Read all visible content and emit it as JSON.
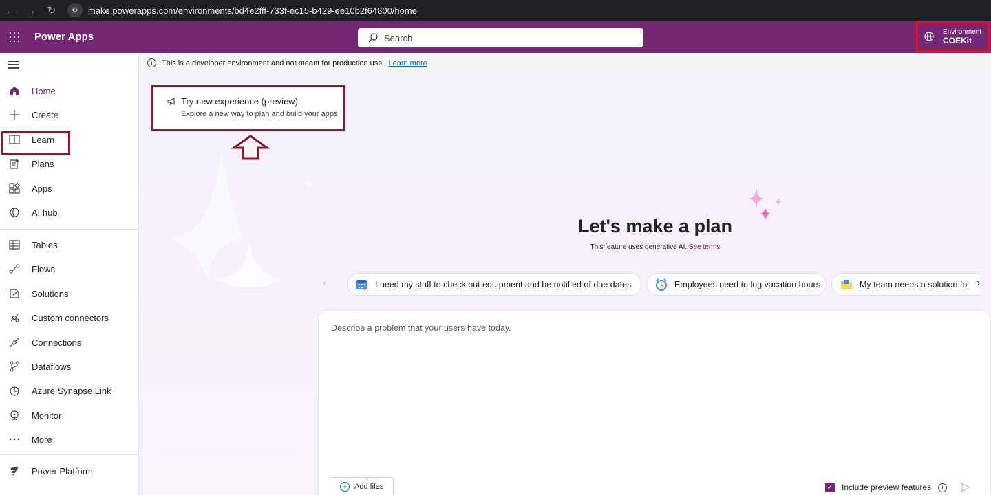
{
  "browser": {
    "url": "make.powerapps.com/environments/bd4e2fff-733f-ec15-b429-ee10b2f64800/home"
  },
  "header": {
    "app_title": "Power Apps",
    "search_placeholder": "Search",
    "environment_label": "Environment",
    "environment_name": "COEKit"
  },
  "sidebar": {
    "items": [
      {
        "label": "Home",
        "icon": "home-icon"
      },
      {
        "label": "Create",
        "icon": "plus-icon"
      },
      {
        "label": "Learn",
        "icon": "book-icon"
      },
      {
        "label": "Plans",
        "icon": "plans-icon"
      },
      {
        "label": "Apps",
        "icon": "apps-icon"
      },
      {
        "label": "AI hub",
        "icon": "ai-hub-icon"
      },
      {
        "label": "Tables",
        "icon": "table-icon"
      },
      {
        "label": "Flows",
        "icon": "flows-icon"
      },
      {
        "label": "Solutions",
        "icon": "solutions-icon"
      },
      {
        "label": "Custom connectors",
        "icon": "custom-connectors-icon"
      },
      {
        "label": "Connections",
        "icon": "connections-icon"
      },
      {
        "label": "Dataflows",
        "icon": "dataflows-icon"
      },
      {
        "label": "Azure Synapse Link",
        "icon": "synapse-icon"
      },
      {
        "label": "Monitor",
        "icon": "monitor-icon"
      },
      {
        "label": "More",
        "icon": "more-icon"
      },
      {
        "label": "Power Platform",
        "icon": "power-platform-icon"
      }
    ]
  },
  "notice": {
    "text": "This is a developer environment and not meant for production use.",
    "link": "Learn more"
  },
  "try_card": {
    "title": "Try new experience (preview)",
    "subtitle": "Explore a new way to plan and build your apps"
  },
  "hero": {
    "heading": "Let's make a plan",
    "subtext": "This feature uses generative AI.",
    "terms_link": "See terms"
  },
  "suggestions": [
    {
      "text": "I need my staff to check out equipment and be notified of due dates",
      "icon": "calendar-icon"
    },
    {
      "text": "Employees need to log vacation hours",
      "icon": "clock-icon"
    },
    {
      "text": "My team needs a solution fo",
      "icon": "folder-icon"
    }
  ],
  "prompt": {
    "placeholder": "Describe a problem that your users have today.",
    "add_files": "Add files",
    "include_preview": "Include preview features",
    "include_preview_checked": true
  },
  "colors": {
    "brand": "#742774",
    "highlight_box": "#8b1a2b",
    "env_box": "#e81123"
  }
}
